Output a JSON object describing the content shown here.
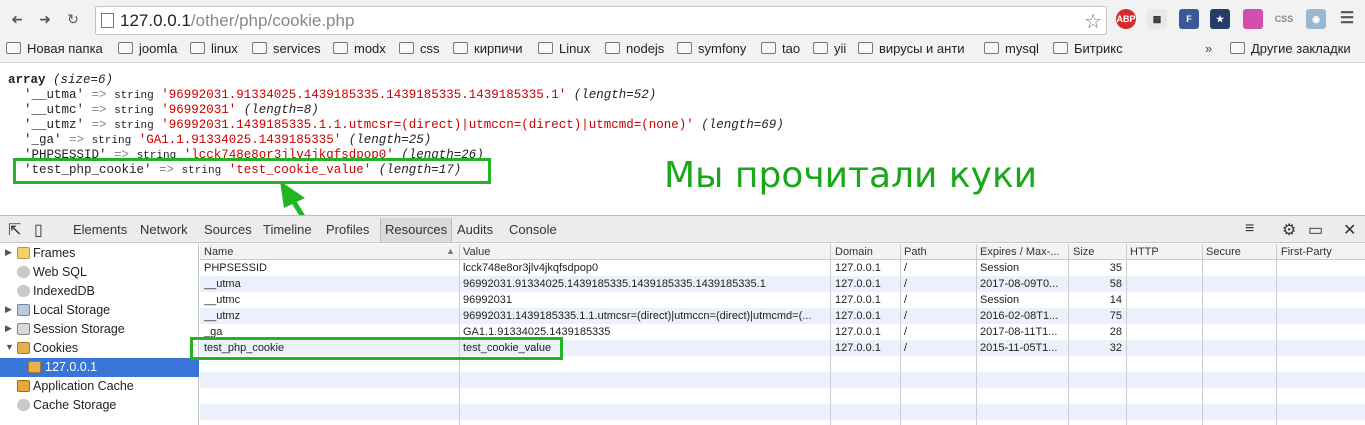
{
  "browser": {
    "url_host": "127.0.0.1",
    "url_path": "/other/php/cookie.php",
    "extensions": [
      "ABP",
      "CSS"
    ]
  },
  "bookmarks": {
    "items": [
      "Новая папка",
      "joomla",
      "linux",
      "services",
      "modx",
      "css",
      "кирпичи",
      "Linux",
      "nodejs",
      "symfony",
      "tao",
      "yii",
      "вирусы и анти",
      "mysql",
      "Битрикс"
    ],
    "more": "»",
    "other": "Другие закладки"
  },
  "dump": {
    "header_kw": "array",
    "header_size": "(size=6)",
    "rows": [
      {
        "key": "'__utma'",
        "type": "string",
        "value": "'96992031.91334025.1439185335.1439185335.1439185335.1'",
        "length": "(length=52)"
      },
      {
        "key": "'__utmc'",
        "type": "string",
        "value": "'96992031'",
        "length": "(length=8)"
      },
      {
        "key": "'__utmz'",
        "type": "string",
        "value": "'96992031.1439185335.1.1.utmcsr=(direct)|utmccn=(direct)|utmcmd=(none)'",
        "length": "(length=69)"
      },
      {
        "key": "'_ga'",
        "type": "string",
        "value": "'GA1.1.91334025.1439185335'",
        "length": "(length=25)"
      },
      {
        "key": "'PHPSESSID'",
        "type": "string",
        "value": "'lcck748e8or3jlv4jkqfsdpop0'",
        "length": "(length=26)"
      },
      {
        "key": "'test_php_cookie'",
        "type": "string",
        "value": "'test_cookie_value'",
        "length": "(length=17)"
      }
    ],
    "arrow": "=>"
  },
  "annotation": {
    "text": "Мы прочитали куки",
    "color": "#1aa81a"
  },
  "devtools": {
    "tabs": [
      "Elements",
      "Network",
      "Sources",
      "Timeline",
      "Profiles",
      "Resources",
      "Audits",
      "Console"
    ],
    "active_tab": "Resources",
    "sidebar": [
      {
        "label": "Frames",
        "expandable": true
      },
      {
        "label": "Web SQL",
        "expandable": false
      },
      {
        "label": "IndexedDB",
        "expandable": false
      },
      {
        "label": "Local Storage",
        "expandable": true
      },
      {
        "label": "Session Storage",
        "expandable": true
      },
      {
        "label": "Cookies",
        "expandable": true
      },
      {
        "label": "127.0.0.1",
        "expandable": false
      },
      {
        "label": "Application Cache",
        "expandable": false
      },
      {
        "label": "Cache Storage",
        "expandable": false
      }
    ],
    "columns": [
      "Name",
      "Value",
      "Domain",
      "Path",
      "Expires / Max-...",
      "Size",
      "HTTP",
      "Secure",
      "First-Party"
    ],
    "rows": [
      [
        "PHPSESSID",
        "lcck748e8or3jlv4jkqfsdpop0",
        "127.0.0.1",
        "/",
        "Session",
        "35",
        "",
        "",
        ""
      ],
      [
        "__utma",
        "96992031.91334025.1439185335.1439185335.1439185335.1",
        "127.0.0.1",
        "/",
        "2017-08-09T0...",
        "58",
        "",
        "",
        ""
      ],
      [
        "__utmc",
        "96992031",
        "127.0.0.1",
        "/",
        "Session",
        "14",
        "",
        "",
        ""
      ],
      [
        "__utmz",
        "96992031.1439185335.1.1.utmcsr=(direct)|utmccn=(direct)|utmcmd=(...",
        "127.0.0.1",
        "/",
        "2016-02-08T1...",
        "75",
        "",
        "",
        ""
      ],
      [
        "_ga",
        "GA1.1.91334025.1439185335",
        "127.0.0.1",
        "/",
        "2017-08-11T1...",
        "28",
        "",
        "",
        ""
      ],
      [
        "test_php_cookie",
        "test_cookie_value",
        "127.0.0.1",
        "/",
        "2015-11-05T1...",
        "32",
        "",
        "",
        ""
      ]
    ]
  }
}
